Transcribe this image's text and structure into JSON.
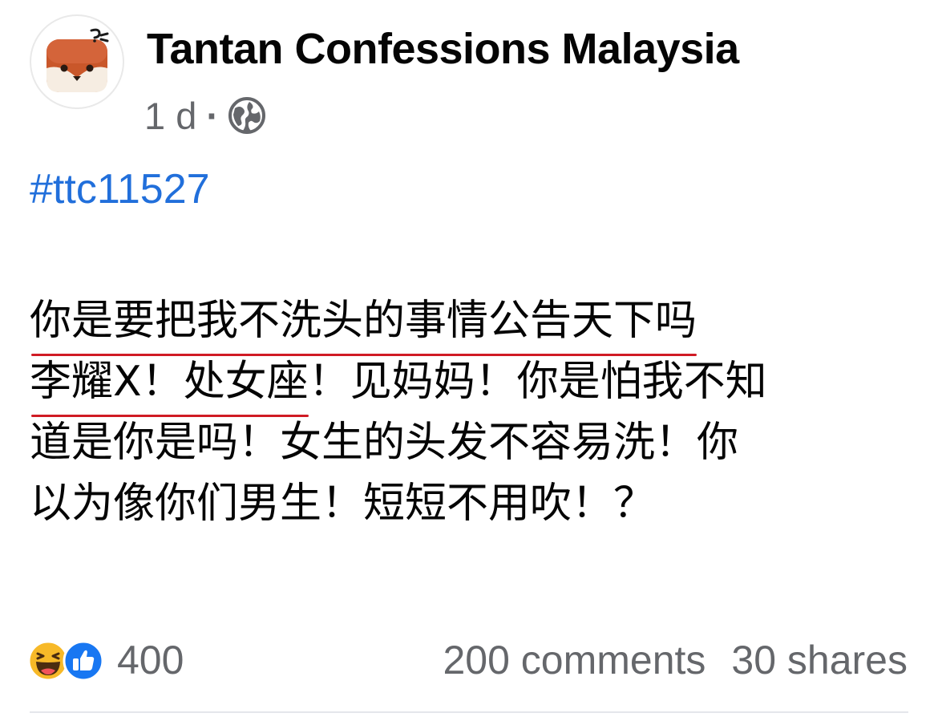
{
  "post": {
    "page_name": "Tantan Confessions Malaysia",
    "time_ago": "1 d",
    "separator": "·",
    "privacy_icon": "globe-icon",
    "hashtag": "#ttc11527",
    "body_lines": [
      "你是要把我不洗头的事情公告天下吗",
      "李耀X！处女座",
      "！见妈妈！你是怕我不知",
      "道是你是吗！女生的头发不容易洗！你",
      "以为像你们男生！短短不用吹！？"
    ],
    "reactions": {
      "icons": [
        "haha-emoji-icon",
        "like-thumb-icon"
      ],
      "count": "400"
    },
    "comments": "200 comments",
    "shares": "30 shares"
  },
  "colors": {
    "hashtag": "#216fdb",
    "secondary_text": "#65676b",
    "underline": "#d01b24",
    "like_blue": "#1877f2",
    "haha_yellow": "#f7b928",
    "avatar_brown": "#c9572a"
  }
}
